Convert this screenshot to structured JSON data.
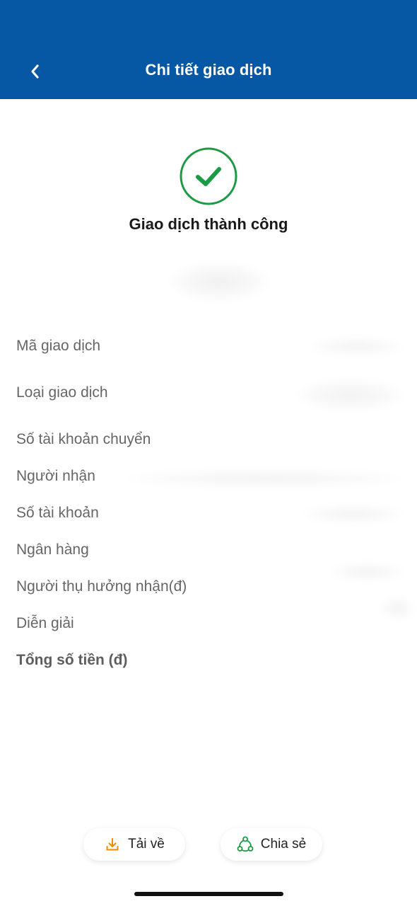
{
  "header": {
    "title": "Chi tiết giao dịch",
    "background_color": "#0658a5"
  },
  "status": {
    "text": "Giao dịch thành công",
    "icon": "check-circle-icon",
    "color": "#1a9a43"
  },
  "details": [
    {
      "label": "Mã giao dịch"
    },
    {
      "label": "Loại giao dịch"
    },
    {
      "label": "Số tài khoản chuyển"
    },
    {
      "label": "Người nhận"
    },
    {
      "label": "Số tài khoản"
    },
    {
      "label": "Ngân hàng"
    },
    {
      "label": "Người thụ hưởng nhận(đ)"
    },
    {
      "label": "Diễn giải"
    },
    {
      "label": "Tổng số tiền (đ)"
    }
  ],
  "actions": {
    "download_label": "Tải về",
    "download_icon": "download-icon",
    "download_icon_color": "#f08a00",
    "share_label": "Chia sẻ",
    "share_icon": "share-icon",
    "share_icon_color": "#1a9a43"
  }
}
